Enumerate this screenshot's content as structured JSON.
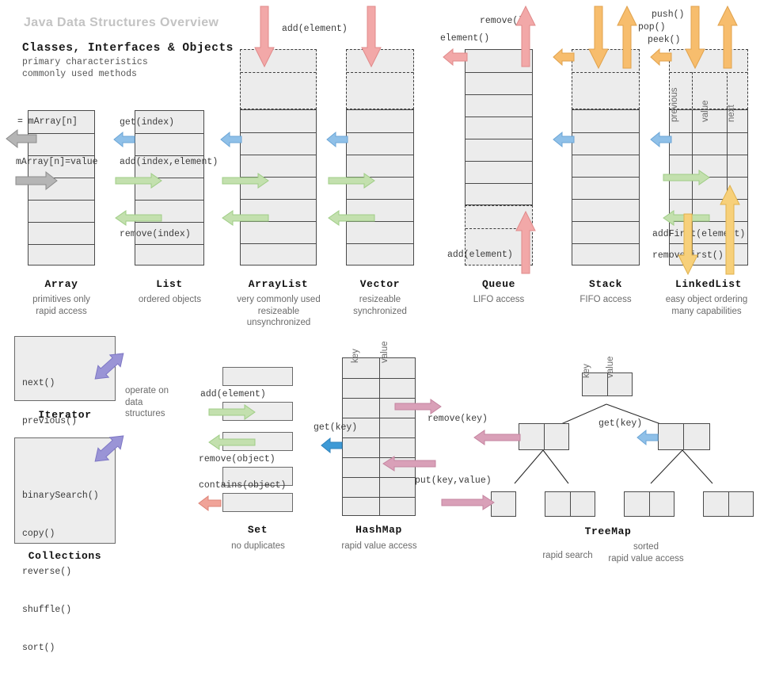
{
  "page": {
    "title": "Java Data Structures Overview",
    "heading": "Classes, Interfaces & Objects",
    "subtitle_1": "primary characteristics",
    "subtitle_2": "commonly used methods"
  },
  "colors": {
    "title": "#c3c3c3",
    "cell_fill": "#ececec",
    "cell_border": "#4a4a4a",
    "arrow_red": "#f2a8a8",
    "arrow_blue": "#8fc0e8",
    "arrow_green": "#c3e0ae",
    "arrow_orange": "#f7bd6d",
    "arrow_gray": "#b5b5b5",
    "arrow_purple": "#9a94d6",
    "arrow_pink": "#d9a0b8"
  },
  "structures": [
    {
      "id": "array",
      "name": "Array",
      "desc": [
        "primitives only",
        "rapid access"
      ],
      "methods": [
        "= mArray[n]",
        "mArray[n]=value"
      ],
      "rows": 7,
      "arrows": [
        "gray-left-read",
        "gray-right-write"
      ]
    },
    {
      "id": "list",
      "name": "List",
      "desc": [
        "ordered objects"
      ],
      "methods": [
        "get(index)",
        "add(index,element)",
        "remove(index)"
      ],
      "rows": 7,
      "arrows": [
        "blue-left-get",
        "green-right-add",
        "green-left-remove"
      ]
    },
    {
      "id": "arraylist",
      "name": "ArrayList",
      "desc": [
        "very commonly used",
        "resizeable",
        "unsynchronized"
      ],
      "methods": [
        "add(element)"
      ],
      "rows": 10,
      "arrows": [
        "red-down-add",
        "blue-left-get",
        "green-right-add",
        "green-left-remove"
      ]
    },
    {
      "id": "vector",
      "name": "Vector",
      "desc": [
        "resizeable",
        "synchronized"
      ],
      "methods": [
        "add(element)"
      ],
      "rows": 10,
      "arrows": [
        "red-down-add",
        "blue-left-get",
        "green-right-add",
        "green-left-remove"
      ]
    },
    {
      "id": "queue",
      "name": "Queue",
      "desc": [
        "LIFO access"
      ],
      "methods": [
        "remove()",
        "element()",
        "add(element)"
      ],
      "rows": 10,
      "arrows": [
        "red-up-remove",
        "red-left-element",
        "red-up-add"
      ]
    },
    {
      "id": "stack",
      "name": "Stack",
      "desc": [
        "FIFO access"
      ],
      "methods": [
        "push()",
        "pop()",
        "peek()"
      ],
      "rows": 10,
      "arrows": [
        "orange-down-push",
        "orange-up-pop",
        "orange-left-peek",
        "blue-left-get"
      ]
    },
    {
      "id": "linkedlist",
      "name": "LinkedList",
      "desc": [
        "easy object ordering",
        "many capabilities"
      ],
      "methods": [
        "addFirst(element)",
        "removeFirst()"
      ],
      "column_labels": [
        "previous",
        "value",
        "next"
      ],
      "rows": 10,
      "arrows": [
        "orange-down-push",
        "orange-up-pop",
        "orange-left-peek",
        "blue-left-get",
        "green-right-add",
        "green-left-remove",
        "orange-down-addfirst",
        "orange-up-removefirst"
      ]
    }
  ],
  "iterator": {
    "name": "Iterator",
    "methods": [
      "next()",
      "previous()"
    ]
  },
  "collections": {
    "name": "Collections",
    "methods": [
      "binarySearch()",
      "copy()",
      "reverse()",
      "shuffle()",
      "sort()"
    ]
  },
  "operate_note": [
    "operate on",
    "data",
    "structures"
  ],
  "set": {
    "name": "Set",
    "desc": [
      "no duplicates"
    ],
    "methods": [
      "add(element)",
      "remove(object)",
      "contains(object)"
    ],
    "boxes": 5
  },
  "hashmap": {
    "name": "HashMap",
    "desc": [
      "rapid value access"
    ],
    "column_labels": [
      "key",
      "value"
    ],
    "methods": [
      "get(key)",
      "remove(key)",
      "put(key,value)"
    ],
    "rows": 8
  },
  "treemap": {
    "name": "TreeMap",
    "desc_left": "rapid search",
    "desc_right": [
      "sorted",
      "rapid value access"
    ],
    "column_labels": [
      "key",
      "value"
    ],
    "methods": [
      "get(key)"
    ],
    "nodes": 7
  }
}
